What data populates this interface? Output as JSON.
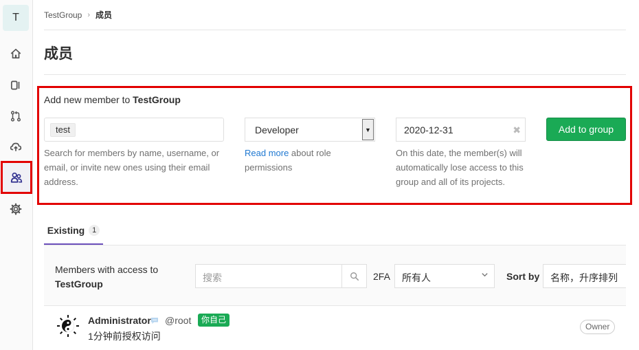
{
  "sidebar": {
    "group_initial": "T",
    "items": [
      {
        "icon": "home-icon"
      },
      {
        "icon": "issues-icon"
      },
      {
        "icon": "merge-request-icon"
      },
      {
        "icon": "cloud-icon"
      },
      {
        "icon": "members-icon",
        "active": true
      },
      {
        "icon": "settings-icon"
      }
    ]
  },
  "breadcrumb": {
    "group": "TestGroup",
    "separator": "›",
    "current": "成员"
  },
  "page": {
    "title": "成员"
  },
  "add_member": {
    "title_prefix": "Add new member to ",
    "title_group": "TestGroup",
    "token": "test",
    "search_help": "Search for members by name, username, or email, or invite new ones using their email address.",
    "role_value": "Developer",
    "role_help_link": "Read more",
    "role_help_rest": " about role permissions",
    "expiry_value": "2020-12-31",
    "expiry_clear": "✖",
    "expiry_help": "On this date, the member(s) will automatically lose access to this group and all of its projects.",
    "submit_label": "Add to group",
    "accent_color": "#1aaa55"
  },
  "tabs": {
    "existing_label": "Existing",
    "existing_count": "1"
  },
  "filter": {
    "title_prefix": "Members with access to",
    "title_group": "TestGroup",
    "search_placeholder": "搜索",
    "twofa_label": "2FA",
    "twofa_value": "所有人",
    "sort_label": "Sort by",
    "sort_value": "名称，升序排列"
  },
  "members": [
    {
      "name": "Administrator",
      "username": "@root",
      "self_badge": "你自己",
      "granted": "1分钟前授权访问",
      "role": "Owner"
    }
  ]
}
